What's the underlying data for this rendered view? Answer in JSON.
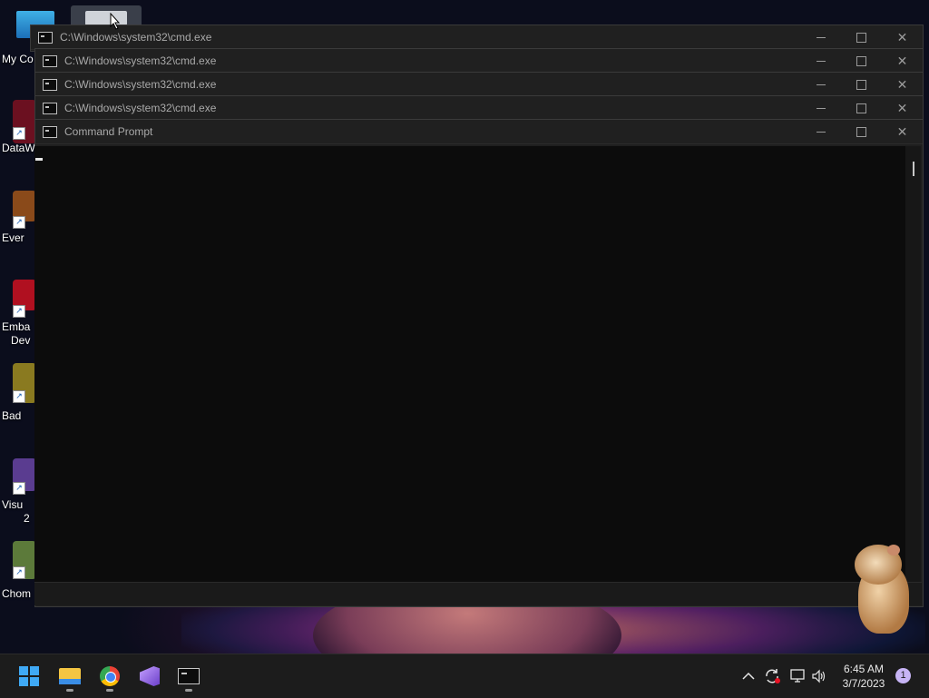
{
  "desktop": {
    "icons": [
      {
        "label": "My Co"
      },
      {
        "label": "DataW"
      },
      {
        "label": "Ever"
      },
      {
        "label": "Emba"
      },
      {
        "label": "Dev"
      },
      {
        "label": "Bad"
      },
      {
        "label": "Visu"
      },
      {
        "label": "2"
      },
      {
        "label": "Chom"
      }
    ]
  },
  "windows": [
    {
      "title": "C:\\Windows\\system32\\cmd.exe"
    },
    {
      "title": "C:\\Windows\\system32\\cmd.exe"
    },
    {
      "title": "C:\\Windows\\system32\\cmd.exe"
    },
    {
      "title": "C:\\Windows\\system32\\cmd.exe"
    },
    {
      "title": "Command Prompt"
    }
  ],
  "window_controls": {
    "close": "✕"
  },
  "taskbar": {
    "apps": [
      {
        "icon": "windows-start-icon"
      },
      {
        "icon": "file-explorer-icon"
      },
      {
        "icon": "chrome-icon"
      },
      {
        "icon": "visual-studio-icon"
      },
      {
        "icon": "terminal-icon"
      }
    ],
    "tray": {
      "chevron": "^",
      "volume": "🔊",
      "time": "6:45 AM",
      "date": "3/7/2023",
      "notifications": "1"
    }
  }
}
